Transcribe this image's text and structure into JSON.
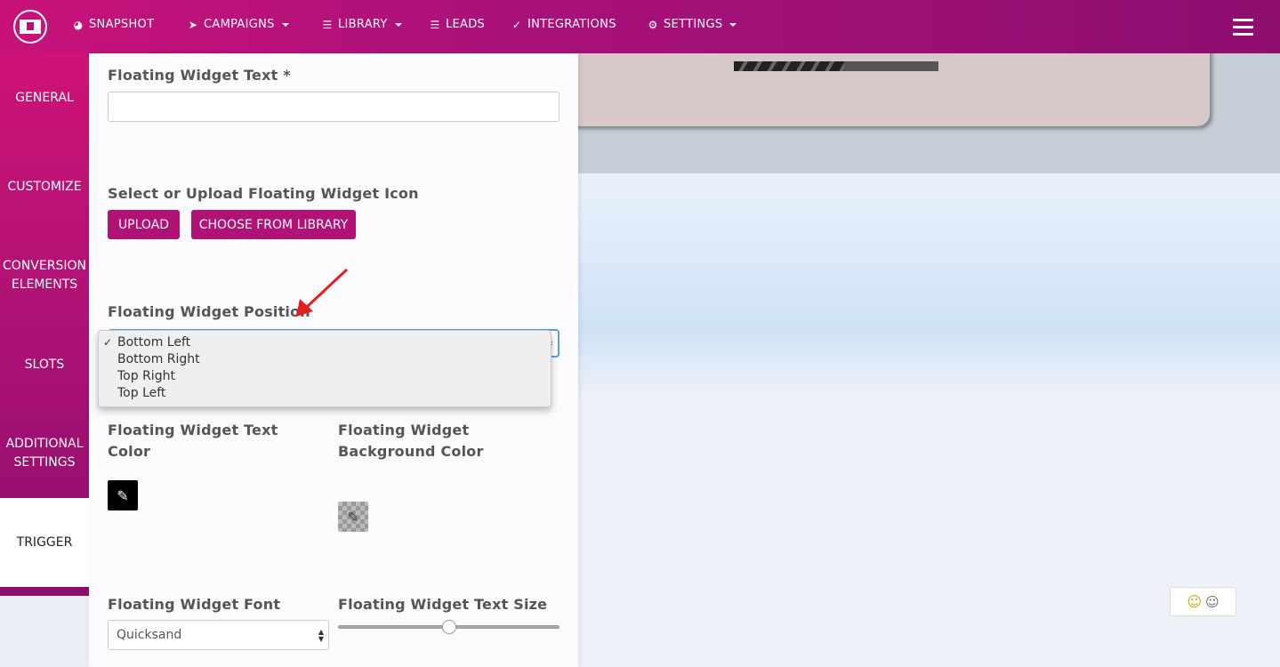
{
  "nav": {
    "items": [
      {
        "label": "SNAPSHOT",
        "icon": "dashboard-icon",
        "dropdown": false
      },
      {
        "label": "CAMPAIGNS",
        "icon": "paper-plane-icon",
        "dropdown": true
      },
      {
        "label": "LIBRARY",
        "icon": "server-icon",
        "dropdown": true
      },
      {
        "label": "LEADS",
        "icon": "list-icon",
        "dropdown": false
      },
      {
        "label": "INTEGRATIONS",
        "icon": "plug-icon",
        "dropdown": false
      },
      {
        "label": "SETTINGS",
        "icon": "cogs-icon",
        "dropdown": true
      }
    ]
  },
  "sidebar": {
    "tabs": [
      {
        "label": "GENERAL"
      },
      {
        "label": "CUSTOMIZE"
      },
      {
        "label": "CONVERSION ELEMENTS"
      },
      {
        "label": "SLOTS"
      },
      {
        "label": "ADDITIONAL SETTINGS"
      },
      {
        "label": "TRIGGER"
      }
    ],
    "active": "TRIGGER"
  },
  "form": {
    "text_label": "Floating Widget Text *",
    "text_value": "",
    "icon_label": "Select or Upload Floating Widget Icon",
    "upload_button": "UPLOAD",
    "library_button": "CHOOSE FROM LIBRARY",
    "position_label": "Floating Widget Position",
    "position_options": [
      "Bottom Left",
      "Bottom Right",
      "Top Right",
      "Top Left"
    ],
    "position_selected": "Bottom Left",
    "text_color_label": "Floating Widget Text Color",
    "bg_color_label": "Floating Widget Background Color",
    "text_color": "#000000",
    "bg_color": "transparent",
    "font_label": "Floating Widget Font",
    "font_value": "Quicksand",
    "size_label": "Floating Widget Text Size",
    "size_fraction": 0.5
  },
  "preview": {
    "progress_fraction": 0.54
  },
  "colors": {
    "brand": "#b01276",
    "annotation_arrow": "#e02020",
    "select_focus": "#5b9ddc"
  }
}
